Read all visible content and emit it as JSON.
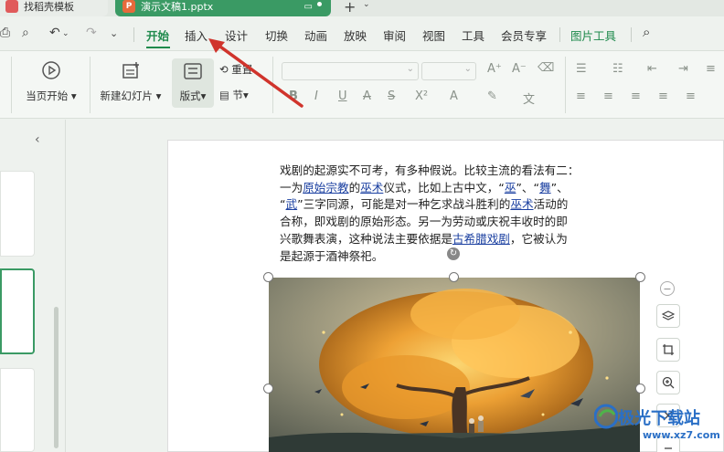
{
  "tabs": {
    "inactive_label": "找稻壳模板",
    "active_label": "演示文稿1.pptx",
    "active_icon": "P",
    "plus": "+",
    "plus_caret": "⌄"
  },
  "menu": {
    "items": [
      "开始",
      "插入",
      "设计",
      "切换",
      "动画",
      "放映",
      "审阅",
      "视图",
      "工具",
      "会员专享",
      "图片工具"
    ],
    "active_index": 0
  },
  "ribbon": {
    "play_from_current": "当页开始",
    "new_slide": "新建幻灯片",
    "layout": "版式",
    "reset": "重置",
    "section": "节"
  },
  "slide_text": {
    "line1": "戏剧的起源实不可考，有多种假说。比较主流的看法有二：",
    "line2a": "一为",
    "link1": "原始宗教",
    "line2b": "的",
    "link2": "巫术",
    "line2c": "仪式，比如上古中文，“",
    "link3": "巫",
    "line2d": "”、“",
    "link4": "舞",
    "line2e": "”、",
    "line3a": "“",
    "link5": "武",
    "line3b": "”三字同源，可能是对一种乞求战斗胜利的",
    "link6": "巫术",
    "line3c": "活动的",
    "line4": "合称，即戏剧的原始形态。另一为劳动或庆祝丰收时的即",
    "line5a": "兴歌舞表演，这种说法主要依据是",
    "link7": "古希腊戏剧",
    "line5b": "，它被认为",
    "line6": "是起源于酒神祭祀。"
  },
  "watermark": {
    "name": "极光下载站",
    "url": "www.xz7.com"
  },
  "colors": {
    "accent": "#1f8a4c",
    "tab_active": "#3a9a64",
    "link": "#1a3fa0",
    "arrow": "#d0342c"
  }
}
